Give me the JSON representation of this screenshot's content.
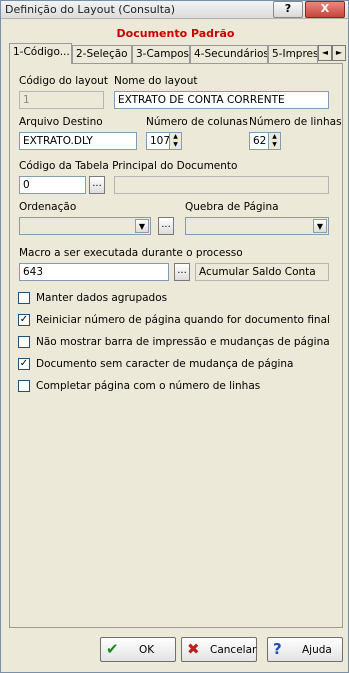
{
  "window": {
    "title": "Definição do Layout (Consulta)",
    "help_glyph": "?",
    "close_glyph": "X"
  },
  "header": {
    "title": "Documento Padrão"
  },
  "tabs": [
    {
      "label": "1-Código..."
    },
    {
      "label": "2-Seleção"
    },
    {
      "label": "3-Campos"
    },
    {
      "label": "4-Secundários"
    },
    {
      "label": "5-Impres"
    }
  ],
  "tab_scroll": {
    "left": "◄",
    "right": "►"
  },
  "form": {
    "codigo_layout": {
      "label": "Código do layout",
      "value": "1"
    },
    "nome_layout": {
      "label": "Nome do layout",
      "value": "EXTRATO DE CONTA CORRENTE"
    },
    "arquivo_destino": {
      "label": "Arquivo Destino",
      "value": "EXTRATO.DLY"
    },
    "numero_colunas": {
      "label": "Número de colunas",
      "value": "107"
    },
    "numero_linhas": {
      "label": "Número de linhas",
      "value": "62"
    },
    "codigo_tabela": {
      "label": "Código da Tabela Principal do Documento",
      "value": "0",
      "description": ""
    },
    "ordenacao": {
      "label": "Ordenação",
      "value": ""
    },
    "quebra_pagina": {
      "label": "Quebra de Página",
      "value": ""
    },
    "macro": {
      "label": "Macro a ser executada durante o processo",
      "value": "643",
      "description": "Acumular Saldo Conta"
    }
  },
  "lookup_glyph": "...",
  "spin_glyphs": {
    "up": "▲",
    "down": "▼"
  },
  "combo_glyph": "▼",
  "checkboxes": [
    {
      "label": "Manter dados agrupados",
      "checked": false
    },
    {
      "label": "Reiniciar número de página quando for documento final",
      "checked": true
    },
    {
      "label": "Não mostrar barra de impressão e mudanças de página",
      "checked": false
    },
    {
      "label": "Documento sem caracter de mudança de página",
      "checked": true
    },
    {
      "label": "Completar página com o número de linhas",
      "checked": false
    }
  ],
  "check_mark": "✓",
  "buttons": {
    "ok": {
      "label": "OK",
      "icon": "✔",
      "icon_name": "check-icon",
      "color": "#1a8a1a"
    },
    "cancel": {
      "label": "Cancelar",
      "icon": "✖",
      "icon_name": "cross-icon",
      "color": "#c0201a"
    },
    "help": {
      "label": "Ajuda",
      "icon": "?",
      "icon_name": "question-icon",
      "color": "#1a4fc0"
    }
  }
}
